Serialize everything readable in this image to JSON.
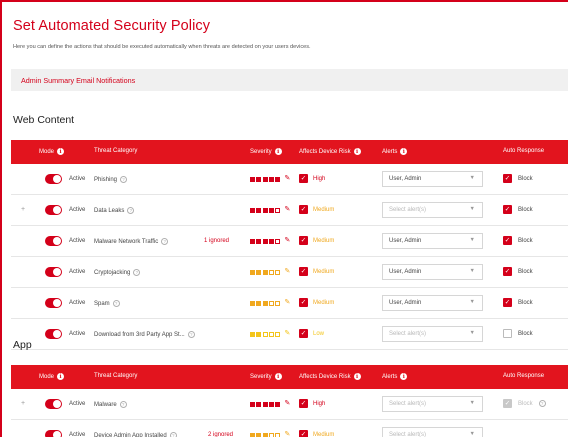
{
  "page": {
    "title": "Set Automated Security Policy",
    "subtitle": "Here you can define the actions that should be executed automatically when threats are detected on your users devices.",
    "summary_label": "Admin Summary Email Notifications"
  },
  "colors": {
    "brand": "#d4001a",
    "header_bg": "#e2141e",
    "high": "#d4001a",
    "medium": "#f0a81e",
    "low": "#f3c51a"
  },
  "columns": {
    "mode": "Mode",
    "category": "Threat Category",
    "severity": "Severity",
    "risk": "Affects Device Risk",
    "alerts": "Alerts",
    "auto": "Auto Response"
  },
  "sections": [
    {
      "title": "Web Content",
      "rows": [
        {
          "expand": "",
          "mode": "Active",
          "category": "Phishing",
          "ignored": "",
          "severity": {
            "level": 5,
            "color": "#d4001a"
          },
          "risk": "High",
          "risk_color": "#d4001a",
          "alerts": "User, Admin",
          "alerts_placeholder": false,
          "auto_checked": true,
          "auto_label": "Block",
          "auto_disabled": false
        },
        {
          "expand": "+",
          "mode": "Active",
          "category": "Data Leaks",
          "ignored": "",
          "severity": {
            "level": 4,
            "color": "#d4001a"
          },
          "risk": "Medium",
          "risk_color": "#f0a81e",
          "alerts": "Select alert(s)",
          "alerts_placeholder": true,
          "auto_checked": true,
          "auto_label": "Block",
          "auto_disabled": false
        },
        {
          "expand": "",
          "mode": "Active",
          "category": "Malware Network Traffic",
          "ignored": "1 ignored",
          "severity": {
            "level": 4,
            "color": "#d4001a"
          },
          "risk": "Medium",
          "risk_color": "#f0a81e",
          "alerts": "User, Admin",
          "alerts_placeholder": false,
          "auto_checked": true,
          "auto_label": "Block",
          "auto_disabled": false
        },
        {
          "expand": "",
          "mode": "Active",
          "category": "Cryptojacking",
          "ignored": "",
          "severity": {
            "level": 3,
            "color": "#f0a81e"
          },
          "risk": "Medium",
          "risk_color": "#f0a81e",
          "alerts": "User, Admin",
          "alerts_placeholder": false,
          "auto_checked": true,
          "auto_label": "Block",
          "auto_disabled": false
        },
        {
          "expand": "",
          "mode": "Active",
          "category": "Spam",
          "ignored": "",
          "severity": {
            "level": 3,
            "color": "#f0a81e"
          },
          "risk": "Medium",
          "risk_color": "#f0a81e",
          "alerts": "User, Admin",
          "alerts_placeholder": false,
          "auto_checked": true,
          "auto_label": "Block",
          "auto_disabled": false
        },
        {
          "expand": "",
          "mode": "Active",
          "category": "Download from 3rd Party App St...",
          "ignored": "",
          "severity": {
            "level": 2,
            "color": "#f3c51a"
          },
          "risk": "Low",
          "risk_color": "#f3c51a",
          "alerts": "Select alert(s)",
          "alerts_placeholder": true,
          "auto_checked": false,
          "auto_label": "Block",
          "auto_disabled": false
        }
      ]
    },
    {
      "title": "App",
      "rows": [
        {
          "expand": "+",
          "mode": "Active",
          "category": "Malware",
          "ignored": "",
          "severity": {
            "level": 5,
            "color": "#d4001a"
          },
          "risk": "High",
          "risk_color": "#d4001a",
          "alerts": "Select alert(s)",
          "alerts_placeholder": true,
          "auto_checked": true,
          "auto_label": "Block",
          "auto_disabled": true
        },
        {
          "expand": "",
          "mode": "Active",
          "category": "Device Admin App Installed",
          "ignored": "2 ignored",
          "severity": {
            "level": 3,
            "color": "#f0a81e"
          },
          "risk": "Medium",
          "risk_color": "#f0a81e",
          "alerts": "Select alert(s)",
          "alerts_placeholder": true,
          "auto_checked": null,
          "auto_label": "",
          "auto_disabled": false
        }
      ]
    }
  ]
}
